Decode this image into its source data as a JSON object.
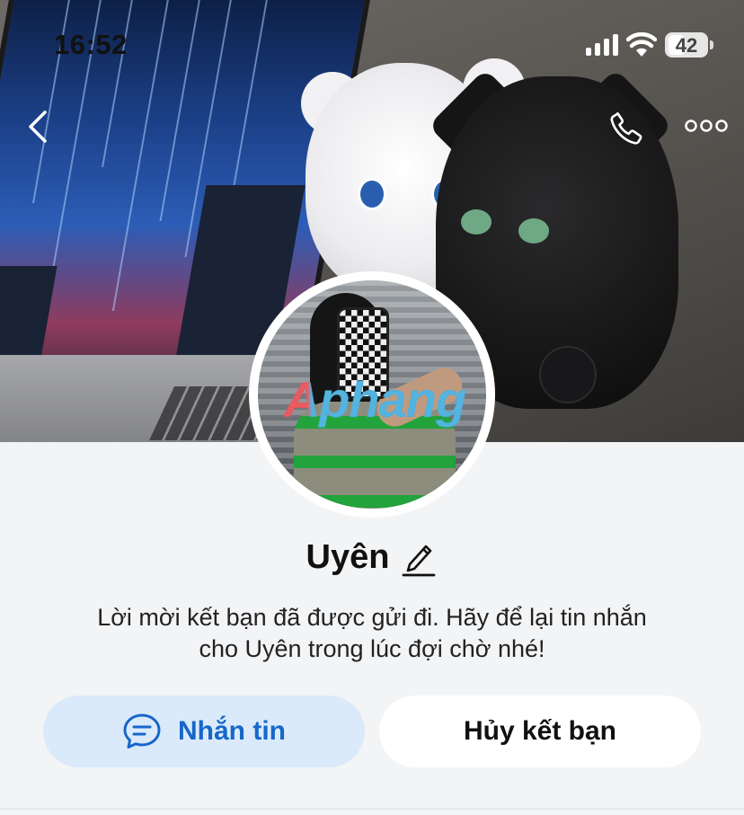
{
  "status_bar": {
    "time": "16:52",
    "battery": "42"
  },
  "header": {
    "back_icon": "chevron-left-icon",
    "call_icon": "phone-icon",
    "more_icon": "more-horizontal-icon"
  },
  "profile": {
    "name": "Uyên",
    "edit_icon": "pencil-icon",
    "watermark": "Aphang",
    "info_line1": "Lời mời kết bạn đã được gửi đi. Hãy để lại tin nhắn",
    "info_line2": "cho Uyên trong lúc đợi chờ nhé!"
  },
  "actions": {
    "message_label": "Nhắn tin",
    "message_icon": "chat-bubble-icon",
    "unfriend_label": "Hủy kết bạn"
  },
  "colors": {
    "accent": "#1767c9",
    "message_bg": "#dbeafb",
    "page_bg": "#f3f4f6"
  }
}
